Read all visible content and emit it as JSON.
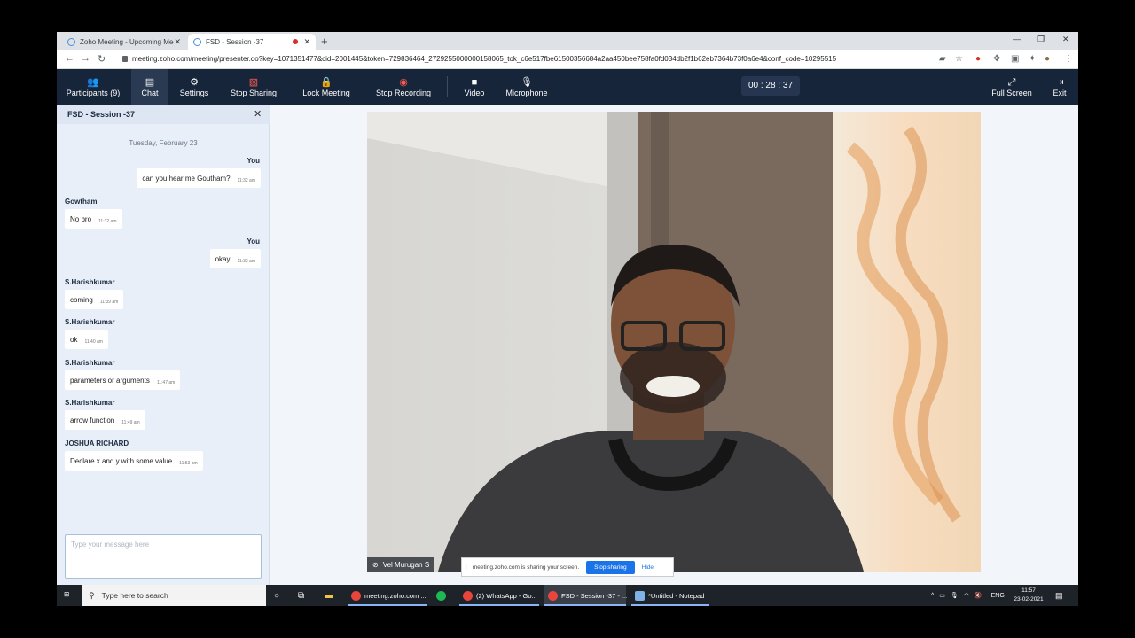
{
  "browser": {
    "tabs": [
      {
        "title": "Zoho Meeting - Upcoming Meeti"
      },
      {
        "title": "FSD - Session -37"
      }
    ],
    "url": "meeting.zoho.com/meeting/presenter.do?key=1071351477&cid=2001445&token=729836464_2729255000000158065_tok_c6e517fbe61500356684a2aa450bee758fa0fd034db2f1b62eb7364b73f0a6e4&conf_code=10295515"
  },
  "toolbar": {
    "participants": "Participants (9)",
    "chat": "Chat",
    "settings": "Settings",
    "stop_sharing": "Stop Sharing",
    "lock_meeting": "Lock Meeting",
    "stop_recording": "Stop Recording",
    "video": "Video",
    "microphone": "Microphone",
    "timer": "00 : 28 : 37",
    "full_screen": "Full Screen",
    "exit": "Exit"
  },
  "chat": {
    "title": "FSD - Session -37",
    "date": "Tuesday, February 23",
    "messages": [
      {
        "sender": "You",
        "text": "can you hear me Goutham?",
        "time": "11:32 am",
        "mine": true
      },
      {
        "sender": "Gowtham",
        "text": "No bro",
        "time": "11:32 am",
        "mine": false
      },
      {
        "sender": "You",
        "text": "okay",
        "time": "11:32 am",
        "mine": true
      },
      {
        "sender": "S.Harishkumar",
        "text": "coming",
        "time": "11:39 am",
        "mine": false
      },
      {
        "sender": "S.Harishkumar",
        "text": "ok",
        "time": "11:40 am",
        "mine": false
      },
      {
        "sender": "S.Harishkumar",
        "text": "parameters or arguments",
        "time": "11:47 am",
        "mine": false
      },
      {
        "sender": "S.Harishkumar",
        "text": "arrow function",
        "time": "11:49 am",
        "mine": false
      },
      {
        "sender": "JOSHUA RICHARD",
        "text": "Declare x and y with some value",
        "time": "11:53 am",
        "mine": false
      }
    ],
    "input_placeholder": "Type your message here"
  },
  "video": {
    "participant_name": "Vel Murugan S"
  },
  "share_notice": {
    "text": "meeting.zoho.com is sharing your screen.",
    "stop": "Stop sharing",
    "hide": "Hide"
  },
  "taskbar": {
    "search_placeholder": "Type here to search",
    "items": [
      {
        "label": "meeting.zoho.com ..."
      },
      {
        "label": "(2) WhatsApp - Go..."
      },
      {
        "label": "FSD - Session -37 - ..."
      },
      {
        "label": "*Untitled - Notepad"
      }
    ],
    "lang": "ENG",
    "time": "11:57",
    "date": "23-02-2021"
  }
}
